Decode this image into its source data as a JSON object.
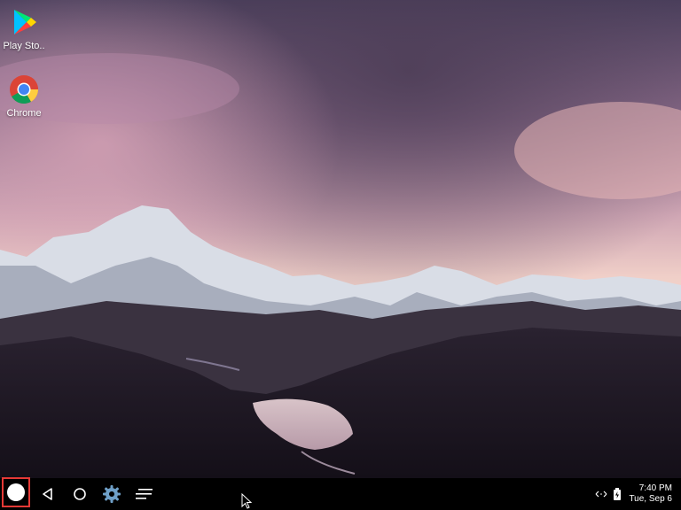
{
  "desktop": {
    "icons": [
      {
        "label": "Play Sto..",
        "icon": "play-store-icon"
      },
      {
        "label": "Chrome",
        "icon": "chrome-icon"
      }
    ]
  },
  "taskbar": {
    "launcher_icon": "launcher-icon",
    "nav": [
      {
        "icon": "back-icon"
      },
      {
        "icon": "home-icon"
      },
      {
        "icon": "settings-gear-icon"
      },
      {
        "icon": "overview-menu-icon"
      }
    ],
    "tray": {
      "network_icon": "network-arrows-icon",
      "battery_icon": "battery-icon",
      "time": "7:40 PM",
      "date": "Tue, Sep 6"
    }
  },
  "colors": {
    "taskbar_bg": "#000000",
    "launcher_highlight": "#e53935",
    "sky_top": "#5a4a6a",
    "sky_glow": "#f2cfc8"
  }
}
